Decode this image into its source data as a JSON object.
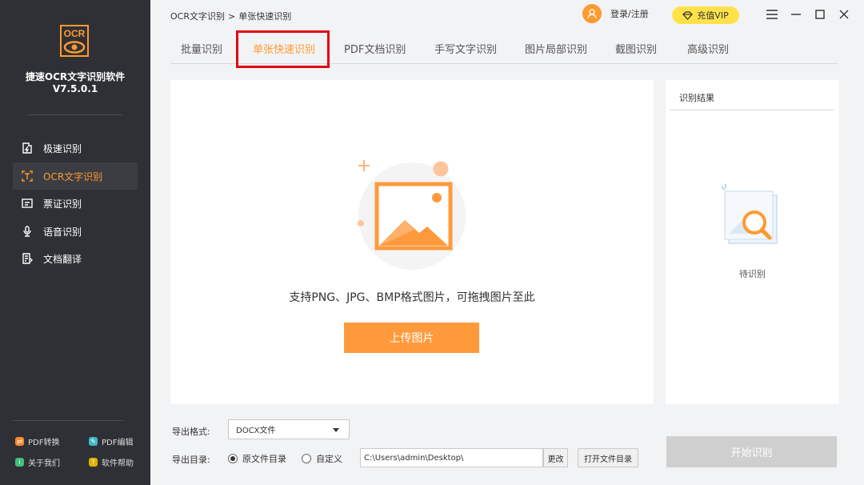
{
  "app": {
    "name": "捷速OCR文字识别软件",
    "version": "V7.5.0.1",
    "logo_text": "OCR"
  },
  "sidebar": {
    "items": [
      {
        "label": "极速识别",
        "icon": "lightning-doc-icon"
      },
      {
        "label": "OCR文字识别",
        "icon": "scan-text-icon",
        "active": true
      },
      {
        "label": "票证识别",
        "icon": "ticket-icon"
      },
      {
        "label": "语音识别",
        "icon": "microphone-icon"
      },
      {
        "label": "文档翻译",
        "icon": "translate-doc-icon"
      }
    ],
    "bottom_links": [
      {
        "label": "PDF转换",
        "color": "#ff8a2e"
      },
      {
        "label": "PDF编辑",
        "color": "#3fb8c9"
      },
      {
        "label": "关于我们",
        "color": "#3fc07a"
      },
      {
        "label": "软件帮助",
        "color": "#e0b000"
      }
    ]
  },
  "topbar": {
    "breadcrumb_root": "OCR文字识别",
    "breadcrumb_sep": ">",
    "breadcrumb_current": "单张快速识别",
    "login_label": "登录/注册",
    "vip_label": "充值VIP"
  },
  "tabs": [
    {
      "label": "批量识别"
    },
    {
      "label": "单张快速识别",
      "active": true
    },
    {
      "label": "PDF文档识别"
    },
    {
      "label": "手写文字识别"
    },
    {
      "label": "图片局部识别"
    },
    {
      "label": "截图识别"
    },
    {
      "label": "高级识别"
    }
  ],
  "upload": {
    "hint": "支持PNG、JPG、BMP格式图片，可拖拽图片至此",
    "button_label": "上传图片"
  },
  "result": {
    "title": "识别结果",
    "status": "待识别"
  },
  "export": {
    "format_label": "导出格式:",
    "format_value": "DOCX文件",
    "dir_label": "导出目录:",
    "radio_source": "原文件目录",
    "radio_custom": "自定义",
    "path_value": "C:\\Users\\admin\\Desktop\\",
    "change_label": "更改",
    "open_dir_label": "打开文件目录"
  },
  "start_label": "开始识别",
  "colors": {
    "accent": "#ff9a2e",
    "sidebar_bg": "#2e3035",
    "vip_bg": "#ffe24a",
    "highlight_border": "#e60012"
  }
}
